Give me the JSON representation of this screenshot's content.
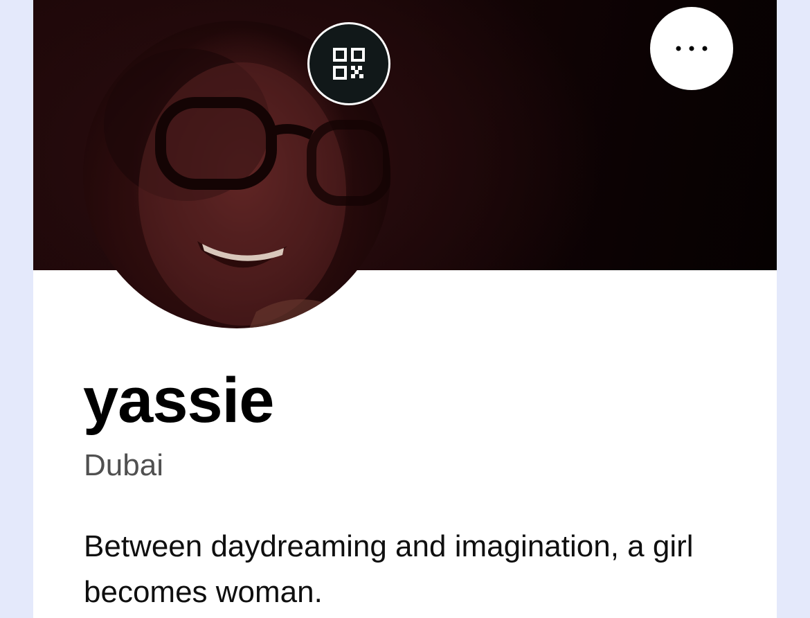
{
  "profile": {
    "name": "yassie",
    "location": "Dubai",
    "bio": "Between daydreaming and imagination, a girl becomes woman."
  },
  "icons": {
    "qr": "qr-code-icon",
    "more": "more-horizontal-icon"
  },
  "colors": {
    "page_background": "#e4e9fb",
    "card_background": "#ffffff",
    "banner_dark": "#1d0708",
    "qr_button_background": "#111819",
    "name_text": "#000000",
    "location_text": "#505050"
  }
}
